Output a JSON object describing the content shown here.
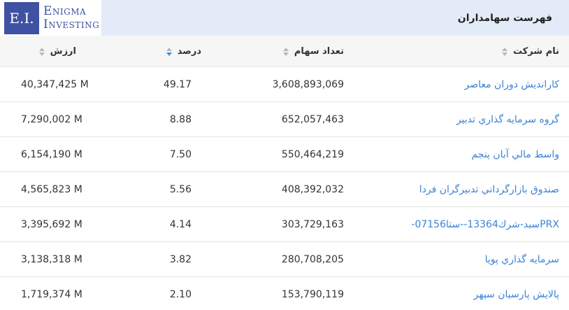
{
  "logo": {
    "initials": "E.I.",
    "line1": "Enigma",
    "line2": "Investing"
  },
  "title": "فهرست سهامداران",
  "columns": {
    "name": "نام شرکت",
    "shares": "تعداد سهام",
    "percent": "درصد",
    "value": "ارزش"
  },
  "sort": {
    "active_column": "percent",
    "direction": "descending"
  },
  "rows": [
    {
      "name": "کارانديش دوران معاصر",
      "shares": "3,608,893,069",
      "percent": "49.17",
      "value": "40,347,425 M"
    },
    {
      "name": "گروه سرمايه گذاري تدبير",
      "shares": "652,057,463",
      "percent": "8.88",
      "value": "7,290,002 M"
    },
    {
      "name": "واسط مالي آبان پنجم",
      "shares": "550,464,219",
      "percent": "7.50",
      "value": "6,154,190 M"
    },
    {
      "name": "صندوق بازارگرداني تدبيرگران فردا",
      "shares": "408,392,032",
      "percent": "5.56",
      "value": "4,565,823 M"
    },
    {
      "name": "PRXسبد-شرك13364--ستا07156-",
      "shares": "303,729,163",
      "percent": "4.14",
      "value": "3,395,692 M"
    },
    {
      "name": "سرمايه گذاري پويا",
      "shares": "280,708,205",
      "percent": "3.82",
      "value": "3,138,318 M"
    },
    {
      "name": "پالايش پارسيان سپهر",
      "shares": "153,790,119",
      "percent": "2.10",
      "value": "1,719,374 M"
    }
  ]
}
